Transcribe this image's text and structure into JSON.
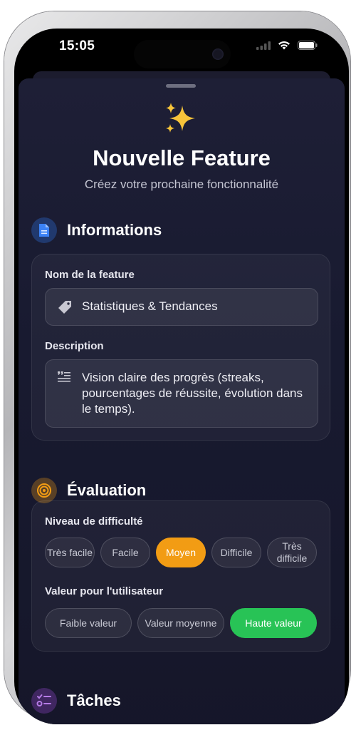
{
  "status_bar": {
    "time": "15:05"
  },
  "header": {
    "emoji": "✨",
    "title": "Nouvelle Feature",
    "subtitle": "Créez votre prochaine fonctionnalité"
  },
  "informations": {
    "title": "Informations",
    "name_label": "Nom de la feature",
    "name_value": "Statistiques & Tendances",
    "description_label": "Description",
    "description_value": "Vision claire des progrès (streaks, pourcentages de réussite, évolution dans le temps)."
  },
  "evaluation": {
    "title": "Évaluation",
    "difficulty_label": "Niveau de difficulté",
    "difficulty_options": [
      "Très facile",
      "Facile",
      "Moyen",
      "Difficile",
      "Très difficile"
    ],
    "difficulty_selected": "Moyen",
    "value_label": "Valeur pour l'utilisateur",
    "value_options": [
      "Faible valeur",
      "Valeur moyenne",
      "Haute valeur"
    ],
    "value_selected": "Haute valeur"
  },
  "tasks": {
    "title": "Tâches"
  },
  "colors": {
    "accent_blue": "#2f6fdc",
    "accent_orange": "#f29c14",
    "accent_green": "#28c356",
    "accent_purple": "#8e44c8"
  }
}
